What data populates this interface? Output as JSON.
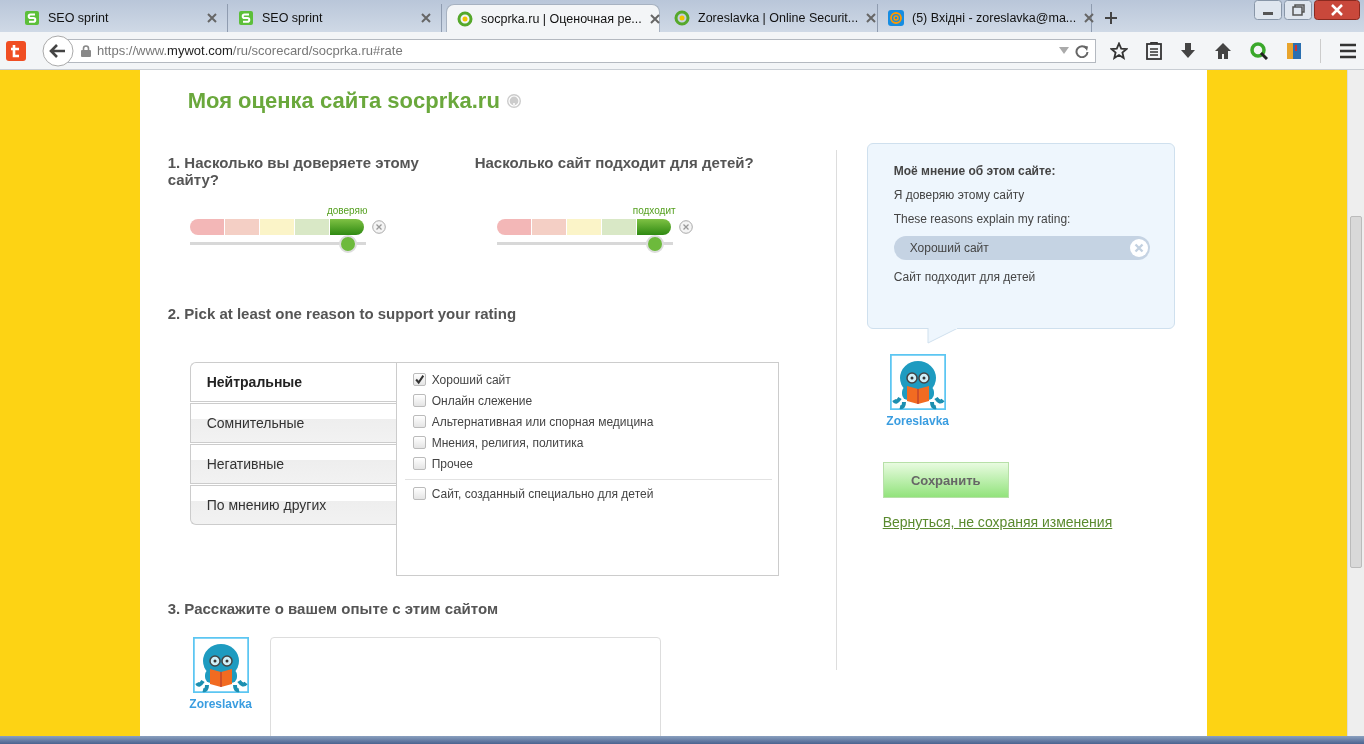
{
  "browser": {
    "tabs": [
      {
        "title": "SEO sprint",
        "kind": "seo",
        "selected": false
      },
      {
        "title": "SEO sprint",
        "kind": "seo",
        "selected": false
      },
      {
        "title": "socprka.ru | Оценочная ре...",
        "kind": "wot",
        "selected": true
      },
      {
        "title": "Zoreslavka | Online Securit...",
        "kind": "wot",
        "selected": false
      },
      {
        "title": "(5) Вхідні - zoreslavka@ma...",
        "kind": "mail",
        "selected": false
      }
    ],
    "url": "https://www.**mywot.com**/ru/scorecard/socprka.ru#rate"
  },
  "page": {
    "title": "Моя оценка сайта socprka.ru",
    "ratings": [
      {
        "question": "1. Насколько вы доверяете этому сайту?",
        "caption": "доверяю",
        "level": 0.9
      },
      {
        "question": "Насколько сайт подходит для детей?",
        "caption": "подходит",
        "level": 0.9
      }
    ],
    "reasons_heading": "2. Pick at least one reason to support your rating",
    "categories": [
      {
        "label": "Нейтральные",
        "selected": true
      },
      {
        "label": "Сомнительные",
        "selected": false
      },
      {
        "label": "Негативные",
        "selected": false
      },
      {
        "label": "По мнению других",
        "selected": false
      }
    ],
    "reasons": [
      {
        "label": "Хороший сайт",
        "checked": true
      },
      {
        "label": "Онлайн слежение",
        "checked": false
      },
      {
        "label": "Альтернативная или спорная медицина",
        "checked": false
      },
      {
        "label": "Мнения, религия, политика",
        "checked": false
      },
      {
        "label": "Прочее",
        "checked": false
      }
    ],
    "kids_reasons": [
      {
        "label": "Сайт, созданный специально для детей",
        "checked": false
      }
    ],
    "experience_heading": "3. Расскажите о вашем опыте с этим сайтом",
    "experience_user": "Zoreslavka",
    "opinion": {
      "heading": "Моё мнение об этом сайте:",
      "trust": "Я доверяю этому сайту",
      "reasons_label": "These reasons explain my rating:",
      "chips": [
        "Хороший сайт"
      ],
      "kids": "Сайт подходит для детей"
    },
    "user": "Zoreslavka",
    "save": "Сохранить",
    "cancel": "Вернуться, не сохраняя изменения"
  }
}
